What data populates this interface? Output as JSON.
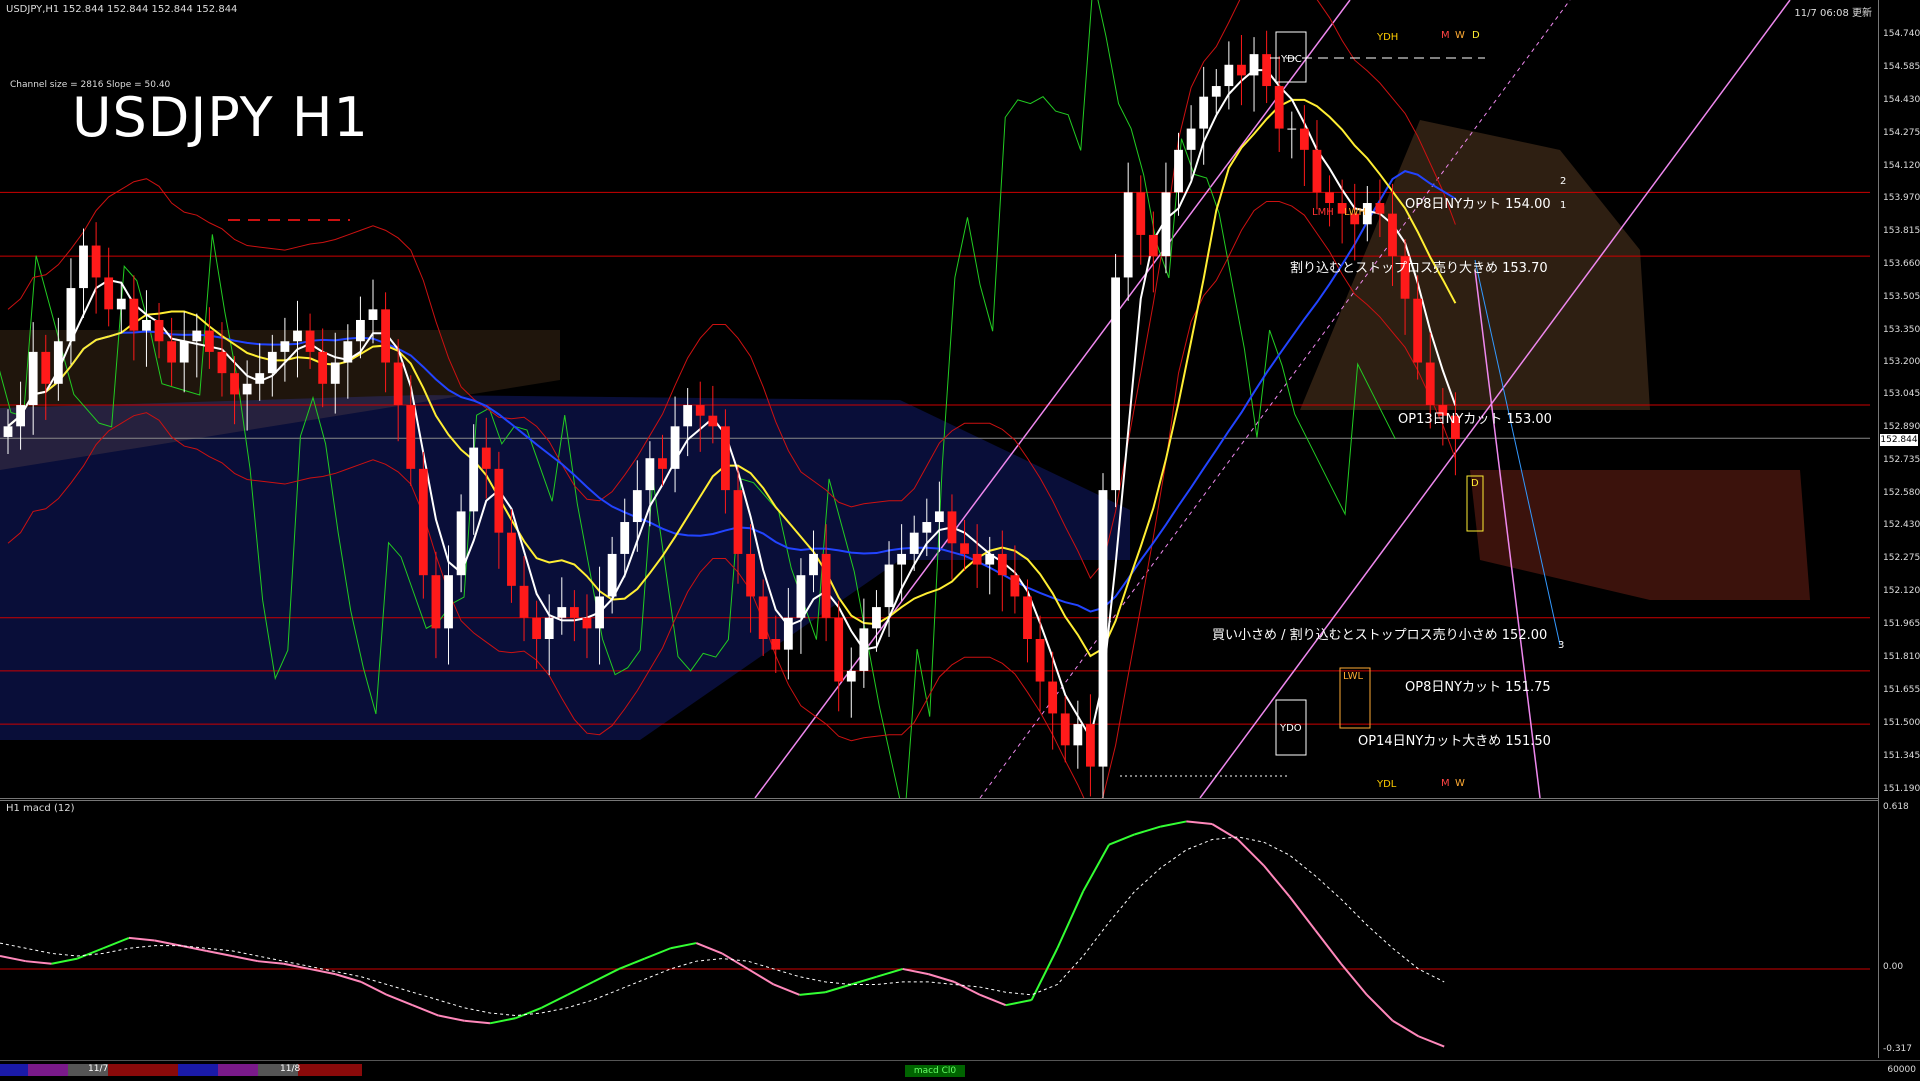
{
  "header": {
    "symbol_info": "USDJPY,H1  152.844 152.844 152.844 152.844",
    "datetime": "11/7 06:08 更新",
    "channel_info": "Channel size = 2816 Slope = 50.40",
    "big_title": "USDJPY H1"
  },
  "macd_title": "H1  macd (12)",
  "current_price": "152.844",
  "annotations": [
    "OP8日NYカット 154.00",
    "割り込むとストップロス売り大きめ 153.70",
    "OP13日NYカット 153.00",
    "買い小さめ / 割り込むとストップロス売り小さめ 152.00",
    "OP8日NYカット 151.75",
    "OP14日NYカット大きめ 151.50"
  ],
  "small_labels": [
    "YDH",
    "M",
    "W",
    "D",
    "YDC",
    "LMH",
    "LWH",
    "D",
    "LWL",
    "YDO",
    "YDL",
    "M",
    "W",
    "1",
    "2",
    "3"
  ],
  "bottom_bar": {
    "label1": "11/7",
    "label2": "11/8",
    "center": "macd Cl0",
    "right": "60000"
  },
  "colors": {
    "up": "#ffffff",
    "down": "#ff1a1a",
    "level_line": "#cc0000",
    "kumo_blue": "#2233cc",
    "kumo_orange": "#ffaa66",
    "macd_up": "#33ff33",
    "macd_down": "#ff88bb",
    "ma_white": "#ffffff",
    "ma_yellow": "#ffee33",
    "ma_blue": "#2244ff"
  },
  "chart_data": [
    {
      "type": "candlestick",
      "title": "USDJPY H1",
      "ylim": [
        151.19,
        154.74
      ],
      "price_ticks": [
        "154.740",
        "154.585",
        "154.430",
        "154.275",
        "154.120",
        "153.970",
        "153.815",
        "153.660",
        "153.505",
        "153.350",
        "153.200",
        "153.045",
        "152.890",
        "152.735",
        "152.580",
        "152.430",
        "152.275",
        "152.120",
        "151.965",
        "151.810",
        "151.655",
        "151.500",
        "151.345",
        "151.190"
      ],
      "horizontal_levels": [
        154.0,
        153.7,
        153.0,
        152.0,
        151.75,
        151.5
      ],
      "close_series": [
        152.9,
        153.0,
        153.25,
        153.1,
        153.3,
        153.55,
        153.75,
        153.6,
        153.45,
        153.5,
        153.35,
        153.4,
        153.3,
        153.2,
        153.3,
        153.35,
        153.25,
        153.15,
        153.05,
        153.1,
        153.15,
        153.25,
        153.3,
        153.35,
        153.25,
        153.1,
        153.2,
        153.3,
        153.4,
        153.45,
        153.2,
        153.0,
        152.7,
        152.2,
        151.95,
        152.2,
        152.5,
        152.8,
        152.7,
        152.4,
        152.15,
        152.0,
        151.9,
        152.0,
        152.05,
        152.0,
        151.95,
        152.1,
        152.3,
        152.45,
        152.6,
        152.75,
        152.7,
        152.9,
        153.0,
        152.95,
        152.9,
        152.6,
        152.3,
        152.1,
        151.9,
        151.85,
        152.0,
        152.2,
        152.3,
        152.0,
        151.7,
        151.75,
        151.95,
        152.05,
        152.25,
        152.3,
        152.4,
        152.45,
        152.5,
        152.35,
        152.3,
        152.25,
        152.3,
        152.2,
        152.1,
        151.9,
        151.7,
        151.55,
        151.4,
        151.5,
        151.3,
        152.6,
        153.6,
        154.0,
        153.8,
        153.7,
        154.0,
        154.2,
        154.3,
        154.45,
        154.5,
        154.6,
        154.55,
        154.65,
        154.5,
        154.3,
        154.3,
        154.2,
        154.0,
        153.95,
        153.9,
        153.85,
        153.95,
        153.9,
        153.7,
        153.5,
        153.2,
        153.0,
        152.95,
        152.84
      ]
    },
    {
      "type": "line",
      "title": "H1  macd (12)",
      "ylim": [
        -0.317,
        0.618
      ],
      "price_ticks": [
        "0.618",
        "0.00",
        "-0.317"
      ],
      "series": [
        {
          "values": [
            0.05,
            0.03,
            0.02,
            0.04,
            0.08,
            0.12,
            0.11,
            0.09,
            0.07,
            0.05,
            0.03,
            0.02,
            0.0,
            -0.02,
            -0.05,
            -0.1,
            -0.14,
            -0.18,
            -0.2,
            -0.21,
            -0.19,
            -0.15,
            -0.1,
            -0.05,
            0.0,
            0.04,
            0.08,
            0.1,
            0.06,
            0.0,
            -0.06,
            -0.1,
            -0.09,
            -0.06,
            -0.03,
            0.0,
            -0.02,
            -0.05,
            -0.1,
            -0.14,
            -0.12,
            0.08,
            0.3,
            0.48,
            0.52,
            0.55,
            0.57,
            0.56,
            0.5,
            0.4,
            0.28,
            0.15,
            0.02,
            -0.1,
            -0.2,
            -0.26,
            -0.3
          ]
        },
        {
          "values": [
            0.1,
            0.08,
            0.06,
            0.05,
            0.06,
            0.08,
            0.09,
            0.09,
            0.08,
            0.07,
            0.05,
            0.03,
            0.01,
            -0.01,
            -0.03,
            -0.06,
            -0.09,
            -0.12,
            -0.15,
            -0.17,
            -0.18,
            -0.17,
            -0.15,
            -0.12,
            -0.08,
            -0.04,
            0.0,
            0.03,
            0.04,
            0.03,
            0.0,
            -0.03,
            -0.05,
            -0.06,
            -0.06,
            -0.05,
            -0.05,
            -0.06,
            -0.07,
            -0.09,
            -0.1,
            -0.06,
            0.05,
            0.18,
            0.3,
            0.39,
            0.46,
            0.5,
            0.51,
            0.49,
            0.44,
            0.36,
            0.27,
            0.17,
            0.08,
            0.0,
            -0.05
          ]
        }
      ]
    }
  ]
}
